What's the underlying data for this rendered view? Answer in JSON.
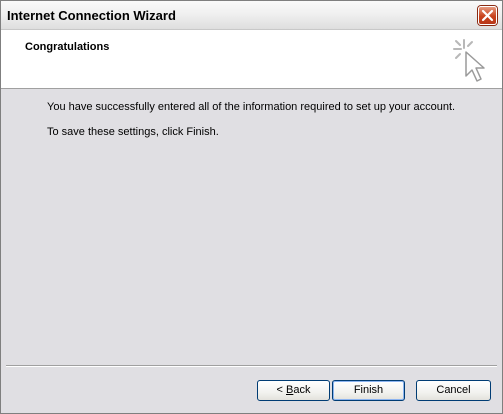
{
  "window": {
    "title": "Internet Connection Wizard"
  },
  "header": {
    "title": "Congratulations"
  },
  "content": {
    "line1": "You have successfully entered all of the information required to set up your account.",
    "line2": "To save these settings, click Finish."
  },
  "buttons": {
    "back_prefix": "< ",
    "back_mnemonic": "B",
    "back_rest": "ack",
    "finish": "Finish",
    "cancel": "Cancel"
  },
  "icons": {
    "close": "close-icon",
    "wizard": "wizard-cursor-icon"
  },
  "colors": {
    "dialog_background": "#e0dfe3",
    "close_button": "#c8421c",
    "default_button_border": "#003c74"
  }
}
